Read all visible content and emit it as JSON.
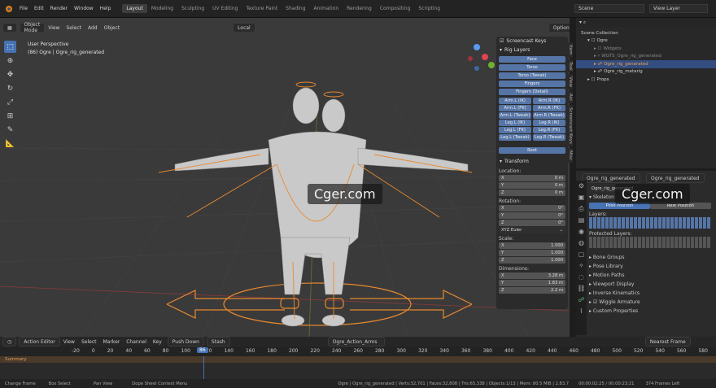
{
  "topbar": {
    "menu": [
      "File",
      "Edit",
      "Render",
      "Window",
      "Help"
    ],
    "workspaces": [
      "Layout",
      "Modeling",
      "Sculpting",
      "UV Editing",
      "Texture Paint",
      "Shading",
      "Animation",
      "Rendering",
      "Compositing",
      "Scripting"
    ],
    "active_workspace": "Layout",
    "scene": "Scene",
    "view_layer": "View Layer",
    "options_label": "Options"
  },
  "viewport": {
    "mode": "Object Mode",
    "menu": [
      "View",
      "Select",
      "Add",
      "Object"
    ],
    "transform": "Local",
    "info_line1": "User Perspective",
    "info_line2": "(86) Ogre | Ogre_rig_generated"
  },
  "npanel": {
    "screencast_label": "Screencast Keys",
    "rig_layers_label": "Rig Layers",
    "buttons_full": [
      "Face",
      "Torso",
      "Torso (Tweak)",
      "Fingers",
      "Fingers (Detail)"
    ],
    "buttons_pairs": [
      [
        "Arm.L (IK)",
        "Arm.R (IK)"
      ],
      [
        "Arm.L (FK)",
        "Arm.R (FK)"
      ],
      [
        "Arm.L (Tweak)",
        "Arm.R (Tweak)"
      ],
      [
        "Leg.L (IK)",
        "Leg.R (IK)"
      ],
      [
        "Leg.L (FK)",
        "Leg.R (FK)"
      ],
      [
        "Leg.L (Tweak)",
        "Leg.R (Tweak)"
      ]
    ],
    "root_label": "Root",
    "transform_label": "Transform",
    "location_label": "Location:",
    "location": [
      [
        "X",
        "0 m"
      ],
      [
        "Y",
        "0 m"
      ],
      [
        "Z",
        "0 m"
      ]
    ],
    "rotation_label": "Rotation:",
    "rotation": [
      [
        "X",
        "0°"
      ],
      [
        "Y",
        "0°"
      ],
      [
        "Z",
        "0°"
      ]
    ],
    "rotation_mode": "XYZ Euler",
    "scale_label": "Scale:",
    "scale": [
      [
        "X",
        "1.000"
      ],
      [
        "Y",
        "1.000"
      ],
      [
        "Z",
        "1.000"
      ]
    ],
    "dimensions_label": "Dimensions:",
    "dimensions": [
      [
        "X",
        "3.28 m"
      ],
      [
        "Y",
        "1.83 m"
      ],
      [
        "Z",
        "2.2 m"
      ]
    ]
  },
  "sidetabs": [
    "Item",
    "Tool",
    "View",
    "Ani",
    "Screencast Keys",
    "Misc"
  ],
  "outliner": {
    "rows": [
      {
        "label": "Scene Collection",
        "indent": 0,
        "sel": false
      },
      {
        "label": "Ogre",
        "indent": 1,
        "sel": false
      },
      {
        "label": "Widgets",
        "indent": 2,
        "sel": false
      },
      {
        "label": "WGTS_Ogre_rig_generated",
        "indent": 2,
        "sel": false
      },
      {
        "label": "Ogre_rig_generated",
        "indent": 2,
        "sel": true
      },
      {
        "label": "Ogre_rig_metarig",
        "indent": 2,
        "sel": false
      },
      {
        "label": "Props",
        "indent": 1,
        "sel": false
      }
    ]
  },
  "props": {
    "object_name": "Ogre_rig_generated",
    "data_name": "Ogre_rig_generated",
    "armature_field": "Ogre_rig_generated",
    "skeleton_label": "Skeleton",
    "pose_position": "Pose Position",
    "rest_position": "Rest Position",
    "layers_label": "Layers:",
    "protected_label": "Protected Layers:",
    "sections": [
      "Bone Groups",
      "Pose Library",
      "Motion Paths",
      "Viewport Display",
      "Inverse Kinematics"
    ],
    "wiggle_label": "Wiggle Armature",
    "custom_label": "Custom Properties"
  },
  "watermark": "Cger.com",
  "dopesheet": {
    "editor": "Action Editor",
    "menu": [
      "View",
      "Select",
      "Marker",
      "Channel",
      "Key"
    ],
    "push_down": "Push Down",
    "stash": "Stash",
    "action": "Ogre_Action_Arms",
    "snapping": "Nearest Frame",
    "summary": "Summary",
    "current_frame": "86",
    "ruler": [
      "-20",
      "0",
      "20",
      "40",
      "60",
      "80",
      "100",
      "120",
      "140",
      "160",
      "180",
      "200",
      "220",
      "240",
      "260",
      "280",
      "300",
      "320",
      "340",
      "360",
      "380",
      "400",
      "420",
      "440",
      "460",
      "480",
      "500",
      "520",
      "540",
      "560",
      "580"
    ]
  },
  "statusbar": {
    "left": [
      "Change Frame",
      "Box Select",
      "Pan View",
      "Dope Sheet Context Menu"
    ],
    "right": "Ogre | Ogre_rig_generated | Verts:32,701 | Faces:32,808 | Tris:65,338 | Objects:1/13 | Mem: 80.5 MiB | 2.83.7",
    "time": "00:00:02:25 / 00:00:23:21",
    "frames_left": "374 Frames Left"
  },
  "colors": {
    "accent": "#4772b3",
    "rig_button": "#5675a7",
    "bone": "#e8892f",
    "selected_row": "#334d80"
  }
}
